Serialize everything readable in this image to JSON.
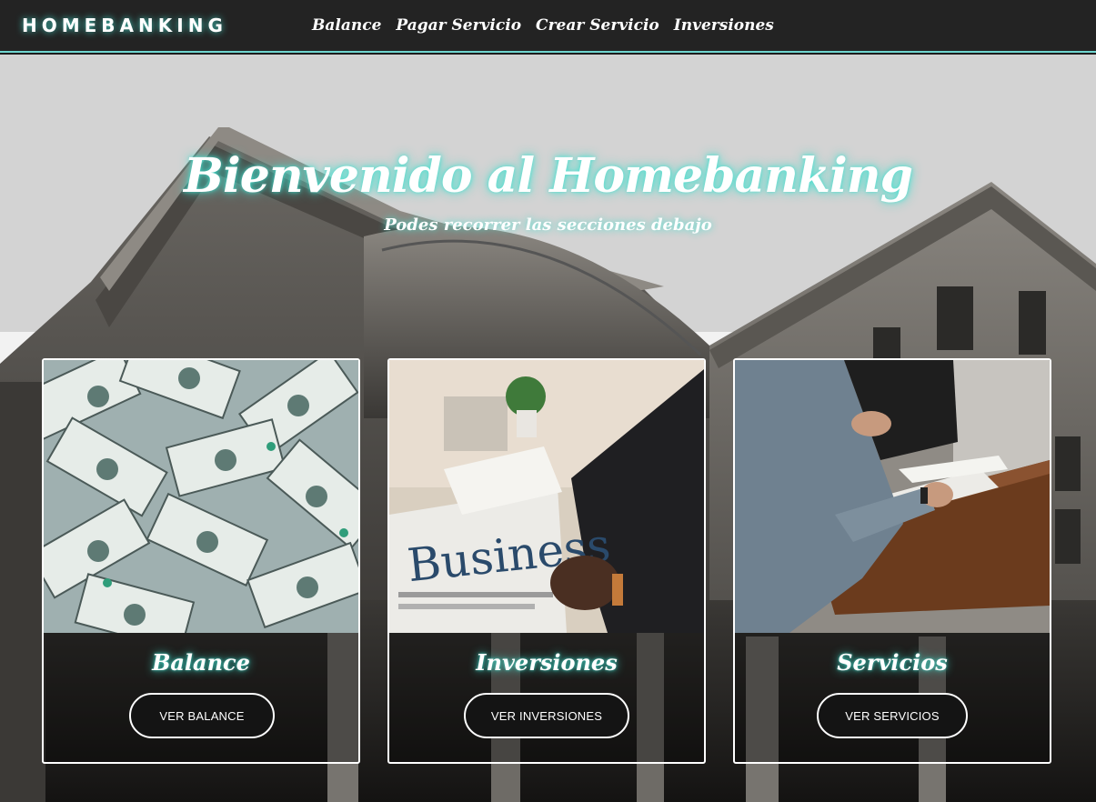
{
  "navbar": {
    "brand": "HOMEBANKING",
    "links": [
      "Balance",
      "Pagar Servicio",
      "Crear Servicio",
      "Inversiones"
    ]
  },
  "hero": {
    "title": "Bienvenido al Homebanking",
    "subtitle": "Podes recorrer las secciones debajo"
  },
  "cards": [
    {
      "title": "Balance",
      "button": "VER BALANCE",
      "image": "money-bills-photo"
    },
    {
      "title": "Inversiones",
      "button": "VER INVERSIONES",
      "image": "business-newspaper-photo",
      "image_text": "Business"
    },
    {
      "title": "Servicios",
      "button": "VER SERVICIOS",
      "image": "meeting-table-photo"
    }
  ],
  "colors": {
    "navbar_bg": "#232323",
    "accent_glow": "#40e0d0",
    "button_bg": "#141414",
    "text": "#ffffff"
  }
}
